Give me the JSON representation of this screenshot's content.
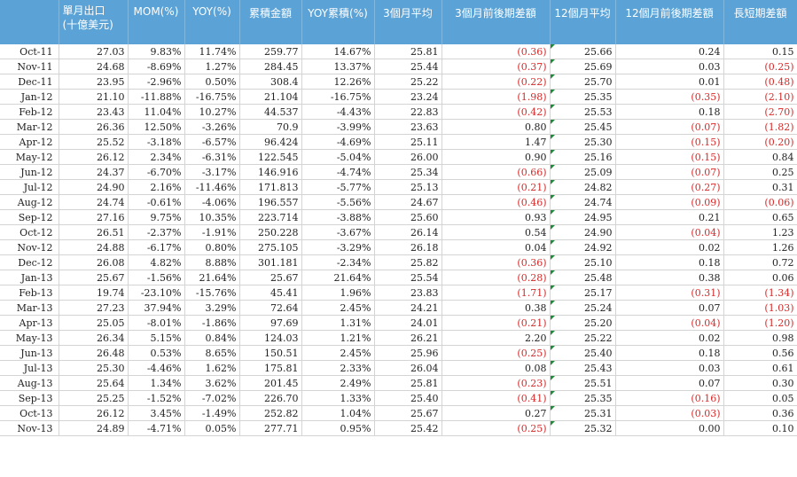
{
  "headers": {
    "month": "",
    "export_line1": "單月出口",
    "export_line2": "(十億美元)",
    "mom": "MOM(%)",
    "yoy": "YOY(%)",
    "cum": "累積金額",
    "yoycum": "YOY累積(%)",
    "avg3": "3個月平均",
    "diff3": "3個月前後期差額",
    "avg12": "12個月平均",
    "diff12": "12個月前後期差額",
    "ls": "長短期差額"
  },
  "rows": [
    {
      "m": "Oct-11",
      "e": "27.03",
      "mom": "9.83%",
      "yoy": "11.74%",
      "cum": "259.77",
      "yc": "14.67%",
      "a3": "25.81",
      "d3": "(0.36)",
      "a12": "25.66",
      "d12": "0.24",
      "ls": "0.15"
    },
    {
      "m": "Nov-11",
      "e": "24.68",
      "mom": "-8.69%",
      "yoy": "1.27%",
      "cum": "284.45",
      "yc": "13.37%",
      "a3": "25.44",
      "d3": "(0.37)",
      "a12": "25.69",
      "d12": "0.03",
      "ls": "(0.25)"
    },
    {
      "m": "Dec-11",
      "e": "23.95",
      "mom": "-2.96%",
      "yoy": "0.50%",
      "cum": "308.4",
      "yc": "12.26%",
      "a3": "25.22",
      "d3": "(0.22)",
      "a12": "25.70",
      "d12": "0.01",
      "ls": "(0.48)"
    },
    {
      "m": "Jan-12",
      "e": "21.10",
      "mom": "-11.88%",
      "yoy": "-16.75%",
      "cum": "21.104",
      "yc": "-16.75%",
      "a3": "23.24",
      "d3": "(1.98)",
      "a12": "25.35",
      "d12": "(0.35)",
      "ls": "(2.10)"
    },
    {
      "m": "Feb-12",
      "e": "23.43",
      "mom": "11.04%",
      "yoy": "10.27%",
      "cum": "44.537",
      "yc": "-4.43%",
      "a3": "22.83",
      "d3": "(0.42)",
      "a12": "25.53",
      "d12": "0.18",
      "ls": "(2.70)"
    },
    {
      "m": "Mar-12",
      "e": "26.36",
      "mom": "12.50%",
      "yoy": "-3.26%",
      "cum": "70.9",
      "yc": "-3.99%",
      "a3": "23.63",
      "d3": "0.80",
      "a12": "25.45",
      "d12": "(0.07)",
      "ls": "(1.82)"
    },
    {
      "m": "Apr-12",
      "e": "25.52",
      "mom": "-3.18%",
      "yoy": "-6.57%",
      "cum": "96.424",
      "yc": "-4.69%",
      "a3": "25.11",
      "d3": "1.47",
      "a12": "25.30",
      "d12": "(0.15)",
      "ls": "(0.20)"
    },
    {
      "m": "May-12",
      "e": "26.12",
      "mom": "2.34%",
      "yoy": "-6.31%",
      "cum": "122.545",
      "yc": "-5.04%",
      "a3": "26.00",
      "d3": "0.90",
      "a12": "25.16",
      "d12": "(0.15)",
      "ls": "0.84"
    },
    {
      "m": "Jun-12",
      "e": "24.37",
      "mom": "-6.70%",
      "yoy": "-3.17%",
      "cum": "146.916",
      "yc": "-4.74%",
      "a3": "25.34",
      "d3": "(0.66)",
      "a12": "25.09",
      "d12": "(0.07)",
      "ls": "0.25"
    },
    {
      "m": "Jul-12",
      "e": "24.90",
      "mom": "2.16%",
      "yoy": "-11.46%",
      "cum": "171.813",
      "yc": "-5.77%",
      "a3": "25.13",
      "d3": "(0.21)",
      "a12": "24.82",
      "d12": "(0.27)",
      "ls": "0.31"
    },
    {
      "m": "Aug-12",
      "e": "24.74",
      "mom": "-0.61%",
      "yoy": "-4.06%",
      "cum": "196.557",
      "yc": "-5.56%",
      "a3": "24.67",
      "d3": "(0.46)",
      "a12": "24.74",
      "d12": "(0.09)",
      "ls": "(0.06)"
    },
    {
      "m": "Sep-12",
      "e": "27.16",
      "mom": "9.75%",
      "yoy": "10.35%",
      "cum": "223.714",
      "yc": "-3.88%",
      "a3": "25.60",
      "d3": "0.93",
      "a12": "24.95",
      "d12": "0.21",
      "ls": "0.65"
    },
    {
      "m": "Oct-12",
      "e": "26.51",
      "mom": "-2.37%",
      "yoy": "-1.91%",
      "cum": "250.228",
      "yc": "-3.67%",
      "a3": "26.14",
      "d3": "0.54",
      "a12": "24.90",
      "d12": "(0.04)",
      "ls": "1.23"
    },
    {
      "m": "Nov-12",
      "e": "24.88",
      "mom": "-6.17%",
      "yoy": "0.80%",
      "cum": "275.105",
      "yc": "-3.29%",
      "a3": "26.18",
      "d3": "0.04",
      "a12": "24.92",
      "d12": "0.02",
      "ls": "1.26"
    },
    {
      "m": "Dec-12",
      "e": "26.08",
      "mom": "4.82%",
      "yoy": "8.88%",
      "cum": "301.181",
      "yc": "-2.34%",
      "a3": "25.82",
      "d3": "(0.36)",
      "a12": "25.10",
      "d12": "0.18",
      "ls": "0.72"
    },
    {
      "m": "Jan-13",
      "e": "25.67",
      "mom": "-1.56%",
      "yoy": "21.64%",
      "cum": "25.67",
      "yc": "21.64%",
      "a3": "25.54",
      "d3": "(0.28)",
      "a12": "25.48",
      "d12": "0.38",
      "ls": "0.06"
    },
    {
      "m": "Feb-13",
      "e": "19.74",
      "mom": "-23.10%",
      "yoy": "-15.76%",
      "cum": "45.41",
      "yc": "1.96%",
      "a3": "23.83",
      "d3": "(1.71)",
      "a12": "25.17",
      "d12": "(0.31)",
      "ls": "(1.34)"
    },
    {
      "m": "Mar-13",
      "e": "27.23",
      "mom": "37.94%",
      "yoy": "3.29%",
      "cum": "72.64",
      "yc": "2.45%",
      "a3": "24.21",
      "d3": "0.38",
      "a12": "25.24",
      "d12": "0.07",
      "ls": "(1.03)"
    },
    {
      "m": "Apr-13",
      "e": "25.05",
      "mom": "-8.01%",
      "yoy": "-1.86%",
      "cum": "97.69",
      "yc": "1.31%",
      "a3": "24.01",
      "d3": "(0.21)",
      "a12": "25.20",
      "d12": "(0.04)",
      "ls": "(1.20)"
    },
    {
      "m": "May-13",
      "e": "26.34",
      "mom": "5.15%",
      "yoy": "0.84%",
      "cum": "124.03",
      "yc": "1.21%",
      "a3": "26.21",
      "d3": "2.20",
      "a12": "25.22",
      "d12": "0.02",
      "ls": "0.98"
    },
    {
      "m": "Jun-13",
      "e": "26.48",
      "mom": "0.53%",
      "yoy": "8.65%",
      "cum": "150.51",
      "yc": "2.45%",
      "a3": "25.96",
      "d3": "(0.25)",
      "a12": "25.40",
      "d12": "0.18",
      "ls": "0.56"
    },
    {
      "m": "Jul-13",
      "e": "25.30",
      "mom": "-4.46%",
      "yoy": "1.62%",
      "cum": "175.81",
      "yc": "2.33%",
      "a3": "26.04",
      "d3": "0.08",
      "a12": "25.43",
      "d12": "0.03",
      "ls": "0.61"
    },
    {
      "m": "Aug-13",
      "e": "25.64",
      "mom": "1.34%",
      "yoy": "3.62%",
      "cum": "201.45",
      "yc": "2.49%",
      "a3": "25.81",
      "d3": "(0.23)",
      "a12": "25.51",
      "d12": "0.07",
      "ls": "0.30"
    },
    {
      "m": "Sep-13",
      "e": "25.25",
      "mom": "-1.52%",
      "yoy": "-7.02%",
      "cum": "226.70",
      "yc": "1.33%",
      "a3": "25.40",
      "d3": "(0.41)",
      "a12": "25.35",
      "d12": "(0.16)",
      "ls": "0.05"
    },
    {
      "m": "Oct-13",
      "e": "26.12",
      "mom": "3.45%",
      "yoy": "-1.49%",
      "cum": "252.82",
      "yc": "1.04%",
      "a3": "25.67",
      "d3": "0.27",
      "a12": "25.31",
      "d12": "(0.03)",
      "ls": "0.36"
    },
    {
      "m": "Nov-13",
      "e": "24.89",
      "mom": "-4.71%",
      "yoy": "0.05%",
      "cum": "277.71",
      "yc": "0.95%",
      "a3": "25.42",
      "d3": "(0.25)",
      "a12": "25.32",
      "d12": "0.00",
      "ls": "0.10"
    }
  ],
  "colors": {
    "header_bg": "#5ba3d6",
    "header_text": "#ffffff",
    "negative_text": "#d62a2a",
    "comment_flag": "#1e8a3a"
  }
}
